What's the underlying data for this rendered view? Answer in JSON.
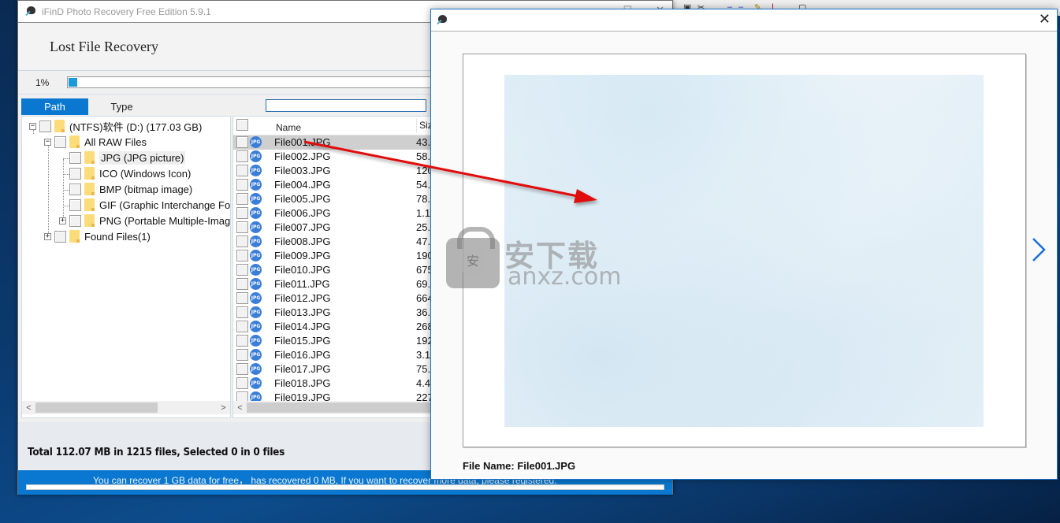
{
  "background_app": {
    "toolbar_icons": [
      "clipboard-icon",
      "cut-icon",
      "minus-icon",
      "minus-icon",
      "edit-icon",
      "text-icon",
      "help-icon"
    ]
  },
  "main_window": {
    "title": "iFinD Photo Recovery Free Edition 5.9.1",
    "controls": {
      "maximize": "☐",
      "close": "✕"
    },
    "header_title": "Lost File Recovery",
    "progress": {
      "label": "1%",
      "value_percent": 1
    },
    "tabs": [
      {
        "label": "Path",
        "active": true
      },
      {
        "label": "Type",
        "active": false
      }
    ],
    "search": {
      "value": "",
      "placeholder": ""
    },
    "tree": [
      {
        "label": "(NTFS)软件 (D:) (177.03 GB)",
        "level": 0,
        "expander": "−"
      },
      {
        "label": "All RAW Files",
        "level": 1,
        "expander": "−"
      },
      {
        "label": "JPG (JPG picture)",
        "level": 2,
        "expander": "",
        "selected": true
      },
      {
        "label": "ICO (Windows Icon)",
        "level": 2,
        "expander": ""
      },
      {
        "label": "BMP (bitmap image)",
        "level": 2,
        "expander": ""
      },
      {
        "label": "GIF (Graphic Interchange For",
        "level": 2,
        "expander": ""
      },
      {
        "label": "PNG (Portable Multiple-Imag",
        "level": 2,
        "expander": "+"
      },
      {
        "label": "Found Files(1)",
        "level": 1,
        "expander": "+"
      }
    ],
    "list": {
      "columns": {
        "name": "Name",
        "size": "Siz"
      },
      "icon_label": "JPG",
      "rows": [
        {
          "name": "File001.JPG",
          "size": "43.",
          "highlighted": true
        },
        {
          "name": "File002.JPG",
          "size": "58."
        },
        {
          "name": "File003.JPG",
          "size": "120"
        },
        {
          "name": "File004.JPG",
          "size": "54."
        },
        {
          "name": "File005.JPG",
          "size": "78."
        },
        {
          "name": "File006.JPG",
          "size": "1.1"
        },
        {
          "name": "File007.JPG",
          "size": "25."
        },
        {
          "name": "File008.JPG",
          "size": "47."
        },
        {
          "name": "File009.JPG",
          "size": "190"
        },
        {
          "name": "File010.JPG",
          "size": "675"
        },
        {
          "name": "File011.JPG",
          "size": "69."
        },
        {
          "name": "File012.JPG",
          "size": "664"
        },
        {
          "name": "File013.JPG",
          "size": "36."
        },
        {
          "name": "File014.JPG",
          "size": "268"
        },
        {
          "name": "File015.JPG",
          "size": "192"
        },
        {
          "name": "File016.JPG",
          "size": "3.1"
        },
        {
          "name": "File017.JPG",
          "size": "75."
        },
        {
          "name": "File018.JPG",
          "size": "4.4"
        },
        {
          "name": "File019.JPG",
          "size": "227"
        }
      ]
    },
    "scroll_arrows": {
      "left": "<",
      "right": ">"
    },
    "status_text": "Total 112.07 MB in 1215 files,  Selected 0 in 0 files",
    "free_notice": "You can recover 1 GB data for free， has recovered 0 MB, If you want to recover more data, please registered."
  },
  "preview_window": {
    "title": "",
    "close": "✕",
    "file_name_label": "File Name: File001.JPG"
  },
  "watermark": {
    "cn": "安下载",
    "en": "anxz.com",
    "shield": "安"
  },
  "colors": {
    "accent_blue": "#0a78d0",
    "progress_fill": "#1a9ad8",
    "annotation_red": "#e01010",
    "next_arrow": "#1a6fd8"
  }
}
